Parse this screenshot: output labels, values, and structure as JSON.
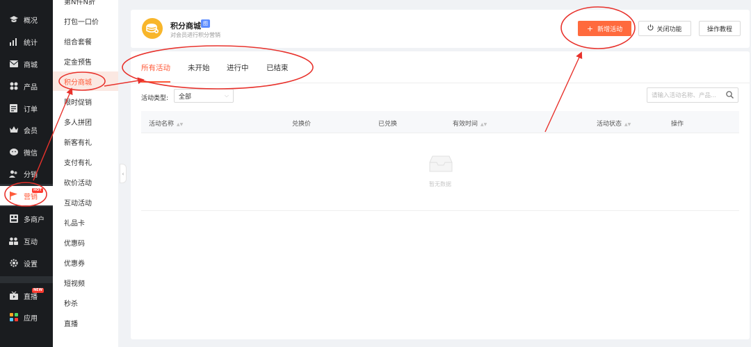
{
  "nav": {
    "items": [
      {
        "label": "概况",
        "icon": "graduation-cap-icon"
      },
      {
        "label": "统计",
        "icon": "bar-chart-icon"
      },
      {
        "label": "商城",
        "icon": "mail-shop-icon"
      },
      {
        "label": "产品",
        "icon": "grid-product-icon"
      },
      {
        "label": "订单",
        "icon": "order-list-icon"
      },
      {
        "label": "会员",
        "icon": "crown-icon"
      },
      {
        "label": "微信",
        "icon": "wechat-icon"
      },
      {
        "label": "分销",
        "icon": "users-icon"
      },
      {
        "label": "营销",
        "icon": "flag-icon",
        "badge": "HOT",
        "active": true
      },
      {
        "label": "多商户",
        "icon": "store-icon"
      },
      {
        "label": "互动",
        "icon": "people-icon"
      },
      {
        "label": "设置",
        "icon": "gear-icon"
      },
      {
        "label": "直播",
        "icon": "tv-icon",
        "badge": "NEW"
      },
      {
        "label": "应用",
        "icon": "apps-icon"
      }
    ]
  },
  "submenu": {
    "cut_off_label": "第N件N折",
    "items": [
      {
        "label": "打包一口价"
      },
      {
        "label": "组合套餐"
      },
      {
        "label": "定金预售"
      },
      {
        "label": "积分商城",
        "active": true
      },
      {
        "label": "限时促销"
      },
      {
        "label": "多人拼团"
      },
      {
        "label": "新客有礼"
      },
      {
        "label": "支付有礼"
      },
      {
        "label": "砍价活动"
      },
      {
        "label": "互动活动"
      },
      {
        "label": "礼品卡"
      },
      {
        "label": "优惠码"
      },
      {
        "label": "优惠券"
      },
      {
        "label": "短视频"
      },
      {
        "label": "秒杀"
      },
      {
        "label": "直播"
      }
    ]
  },
  "header": {
    "title": "积分商城",
    "tag": "图",
    "subtitle": "对会员进行积分营销",
    "buttons": {
      "new_activity": "新增活动",
      "close_feature": "关闭功能",
      "tutorial": "操作教程"
    }
  },
  "tabs": [
    "所有活动",
    "未开始",
    "进行中",
    "已结束"
  ],
  "filter": {
    "label": "活动类型:",
    "selected": "全部",
    "search_placeholder": "请输入活动名称、产品..."
  },
  "table": {
    "columns": [
      "活动名称",
      "兑换价",
      "已兑换",
      "有效时间",
      "活动状态",
      "操作"
    ],
    "empty_text": "暂无数据"
  },
  "colors": {
    "accent": "#ff5b3a",
    "primary_button": "#ff6a3d",
    "nav_bg": "#2b2f33",
    "annotation": "#e8322c"
  }
}
